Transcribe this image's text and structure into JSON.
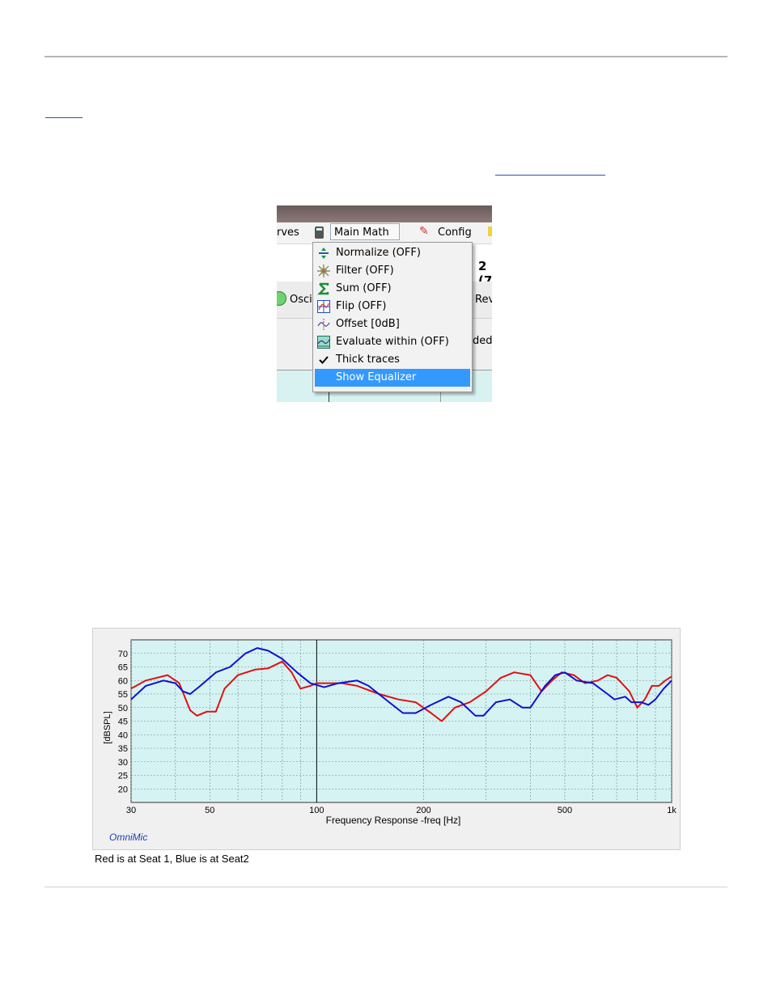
{
  "menu": {
    "toolbar": {
      "curves_label": "rves",
      "main_math_label": "Main Math",
      "config_label": "Config"
    },
    "background": {
      "partial_number": "2 (7",
      "osc_label": "Osci",
      "rev_label": "Rev",
      "ded_label": "ded"
    },
    "items": [
      {
        "label": "Normalize (OFF)",
        "icon": "normalize-icon"
      },
      {
        "label": "Filter (OFF)",
        "icon": "filter-icon"
      },
      {
        "label": "Sum (OFF)",
        "icon": "sum-icon"
      },
      {
        "label": "Flip (OFF)",
        "icon": "flip-icon"
      },
      {
        "label": "Offset [0dB]",
        "icon": "offset-icon"
      },
      {
        "label": "Evaluate within (OFF)",
        "icon": "evaluate-icon"
      },
      {
        "label": "Thick traces",
        "icon": "checkmark-icon",
        "checked": true
      },
      {
        "label": "Show Equalizer",
        "icon": "",
        "highlighted": true
      }
    ]
  },
  "chart_data": {
    "type": "line",
    "xlabel": "Frequency Response -freq [Hz]",
    "ylabel": "[dBSPL]",
    "x_scale": "log",
    "xlim": [
      30,
      1000
    ],
    "ylim": [
      15,
      75
    ],
    "x_ticks": [
      {
        "value": 30,
        "label": "30"
      },
      {
        "value": 50,
        "label": "50"
      },
      {
        "value": 100,
        "label": "100"
      },
      {
        "value": 200,
        "label": "200"
      },
      {
        "value": 500,
        "label": "500"
      },
      {
        "value": 1000,
        "label": "1k"
      }
    ],
    "y_ticks": [
      20,
      25,
      30,
      35,
      40,
      45,
      50,
      55,
      60,
      65,
      70
    ],
    "marker_x": 100,
    "grid": true,
    "watermark": "OmniMic",
    "background_color": "#d6f3f3",
    "series": [
      {
        "color": "#e01010",
        "points": [
          [
            30,
            57
          ],
          [
            33,
            60
          ],
          [
            38,
            62
          ],
          [
            41,
            59
          ],
          [
            44,
            49
          ],
          [
            46,
            47
          ],
          [
            49,
            48.5
          ],
          [
            52,
            48.5
          ],
          [
            55,
            57
          ],
          [
            60,
            62
          ],
          [
            67,
            64
          ],
          [
            73,
            64.5
          ],
          [
            80,
            67
          ],
          [
            85,
            63
          ],
          [
            90,
            57
          ],
          [
            96,
            58
          ],
          [
            100,
            59
          ],
          [
            108,
            59
          ],
          [
            118,
            59
          ],
          [
            130,
            58
          ],
          [
            150,
            55
          ],
          [
            170,
            53
          ],
          [
            190,
            52
          ],
          [
            210,
            48
          ],
          [
            225,
            45
          ],
          [
            245,
            50
          ],
          [
            270,
            52
          ],
          [
            300,
            56
          ],
          [
            330,
            61
          ],
          [
            360,
            63
          ],
          [
            400,
            62
          ],
          [
            430,
            56
          ],
          [
            460,
            60
          ],
          [
            490,
            63
          ],
          [
            530,
            62
          ],
          [
            570,
            59
          ],
          [
            620,
            60
          ],
          [
            660,
            62
          ],
          [
            700,
            61
          ],
          [
            760,
            56
          ],
          [
            800,
            50
          ],
          [
            840,
            53
          ],
          [
            880,
            58
          ],
          [
            920,
            58
          ],
          [
            960,
            60
          ],
          [
            1000,
            61.5
          ]
        ]
      },
      {
        "color": "#1010d0",
        "points": [
          [
            30,
            53
          ],
          [
            33,
            58
          ],
          [
            37,
            60
          ],
          [
            40,
            59
          ],
          [
            42,
            56
          ],
          [
            44,
            55
          ],
          [
            47,
            58
          ],
          [
            52,
            63
          ],
          [
            57,
            65
          ],
          [
            63,
            70
          ],
          [
            68,
            72
          ],
          [
            73,
            71
          ],
          [
            80,
            68
          ],
          [
            88,
            63
          ],
          [
            96,
            59
          ],
          [
            105,
            57.5
          ],
          [
            115,
            59
          ],
          [
            130,
            60
          ],
          [
            140,
            58
          ],
          [
            160,
            52
          ],
          [
            175,
            48
          ],
          [
            190,
            48
          ],
          [
            210,
            51
          ],
          [
            235,
            54
          ],
          [
            255,
            52
          ],
          [
            280,
            47
          ],
          [
            295,
            47
          ],
          [
            320,
            52
          ],
          [
            350,
            53
          ],
          [
            380,
            50
          ],
          [
            400,
            50
          ],
          [
            440,
            58
          ],
          [
            470,
            62
          ],
          [
            500,
            63
          ],
          [
            540,
            60
          ],
          [
            600,
            59
          ],
          [
            660,
            55
          ],
          [
            690,
            53
          ],
          [
            740,
            54
          ],
          [
            770,
            52
          ],
          [
            820,
            52
          ],
          [
            860,
            51
          ],
          [
            900,
            53
          ],
          [
            950,
            57
          ],
          [
            1000,
            60
          ]
        ]
      }
    ]
  },
  "caption": "Red is at Seat 1, Blue is at Seat2"
}
